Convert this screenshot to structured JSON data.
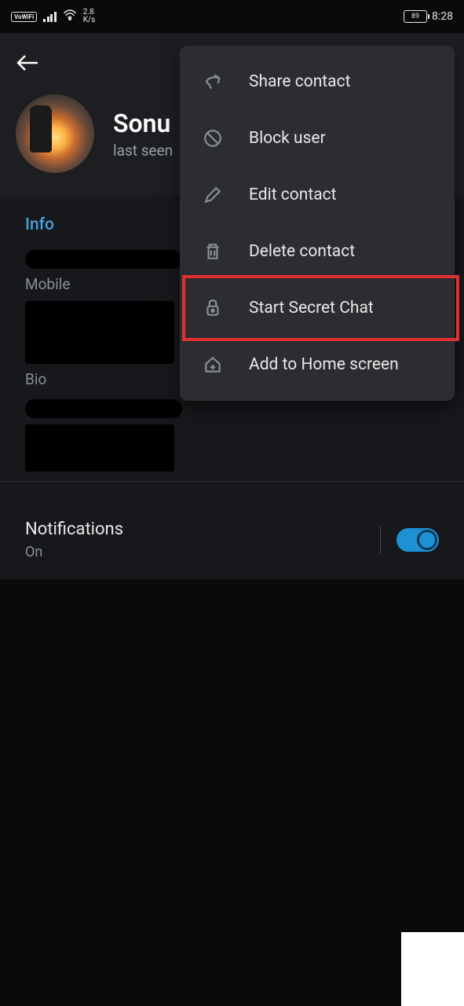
{
  "statusbar": {
    "vowifi": "VoWiFi",
    "netspeed_top": "2.8",
    "netspeed_bottom": "K/s",
    "battery": "89",
    "time": "8:28"
  },
  "profile": {
    "name": "Sonu",
    "last_seen": "last seen"
  },
  "info": {
    "title": "Info",
    "mobile_label": "Mobile",
    "bio_label": "Bio"
  },
  "notifications": {
    "title": "Notifications",
    "status": "On"
  },
  "menu": {
    "share": "Share contact",
    "block": "Block user",
    "edit": "Edit contact",
    "delete": "Delete contact",
    "secret": "Start Secret Chat",
    "home": "Add to Home screen"
  }
}
